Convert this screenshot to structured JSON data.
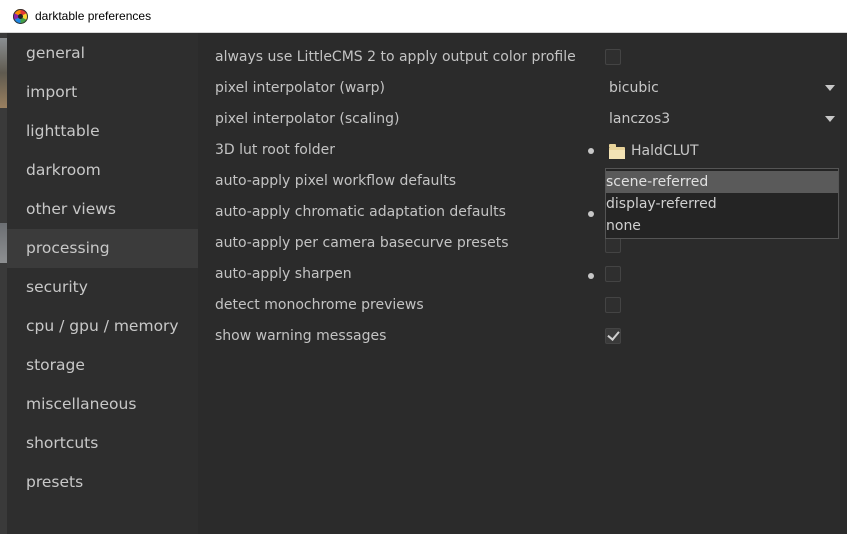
{
  "window": {
    "title": "darktable preferences"
  },
  "sidebar": {
    "items": [
      {
        "label": "general"
      },
      {
        "label": "import"
      },
      {
        "label": "lighttable"
      },
      {
        "label": "darkroom"
      },
      {
        "label": "other views"
      },
      {
        "label": "processing",
        "active": true
      },
      {
        "label": "security"
      },
      {
        "label": "cpu / gpu / memory"
      },
      {
        "label": "storage"
      },
      {
        "label": "miscellaneous"
      },
      {
        "label": "shortcuts"
      },
      {
        "label": "presets"
      }
    ]
  },
  "settings": {
    "use_littlecms": {
      "label": "always use LittleCMS 2 to apply output color profile",
      "checked": false
    },
    "interp_warp": {
      "label": "pixel interpolator (warp)",
      "value": "bicubic"
    },
    "interp_scaling": {
      "label": "pixel interpolator (scaling)",
      "value": "lanczos3"
    },
    "lut_folder": {
      "label": "3D lut root folder",
      "value": "HaldCLUT"
    },
    "workflow_defaults": {
      "label": "auto-apply pixel workflow defaults"
    },
    "chromatic_adaptation": {
      "label": "auto-apply chromatic adaptation defaults"
    },
    "basecurve_presets": {
      "label": "auto-apply per camera basecurve presets",
      "checked": false
    },
    "sharpen": {
      "label": "auto-apply sharpen",
      "checked": false
    },
    "monochrome": {
      "label": "detect monochrome previews",
      "checked": false
    },
    "warnings": {
      "label": "show warning messages",
      "checked": true
    }
  },
  "workflow_popup": {
    "options": [
      "scene-referred",
      "display-referred",
      "none"
    ],
    "selected": "scene-referred"
  },
  "colors": {
    "background": "#2b2b2b",
    "sidebar": "#2e2e2e",
    "active_item": "#3b3b3b",
    "text": "#c3c3c3"
  }
}
